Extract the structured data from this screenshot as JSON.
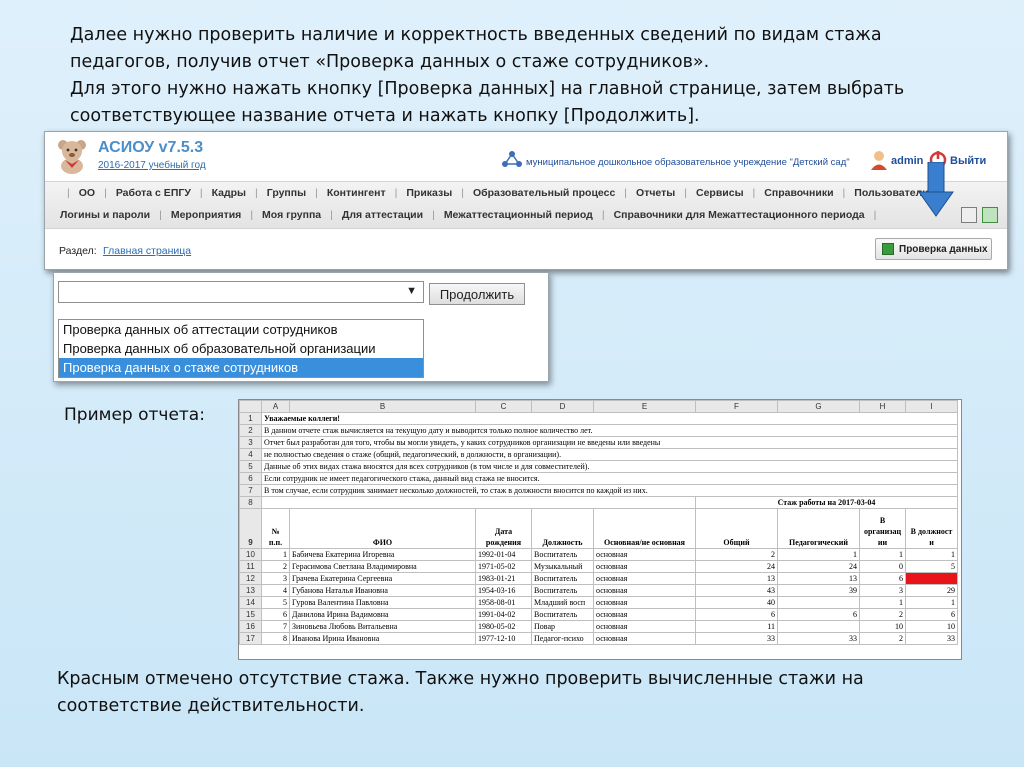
{
  "intro": {
    "line1": "Далее нужно проверить наличие и корректность введенных сведений по видам стажа",
    "line2": "педагогов, получив отчет «Проверка данных о стаже сотрудников».",
    "line3": "Для этого нужно нажать кнопку [Проверка данных] на главной странице, затем выбрать",
    "line4": "соответствующее название отчета и нажать кнопку [Продолжить]."
  },
  "app": {
    "title": "АСИОУ v7.5.3",
    "year": "2016-2017 учебный год",
    "org": "муниципальное дошкольное образовательное учреждение \"Детский сад\"",
    "user": "admin",
    "exit": "Выйти",
    "menu_row1": [
      "ОО",
      "Работа с ЕПГУ",
      "Кадры",
      "Группы",
      "Контингент",
      "Приказы",
      "Образовательный процесс",
      "Отчеты",
      "Сервисы",
      "Справочники",
      "Пользователи"
    ],
    "menu_row2": [
      "Логины и пароли",
      "Мероприятия",
      "Моя группа",
      "Для аттестации",
      "Межаттестационный период",
      "Справочники для Межаттестационного периода"
    ],
    "section_label": "Раздел:",
    "section_link": "Главная страница",
    "check_button": "Проверка данных",
    "colors": {
      "title": "#4a8fc9",
      "link": "#2a6db0",
      "highlight_arrow": "#3a7fcf"
    }
  },
  "dropdown": {
    "selected": "",
    "continue_button": "Продолжить",
    "options": [
      "Проверка данных об аттестации сотрудников",
      "Проверка данных об образовательной организации",
      "Проверка данных о стаже сотрудников"
    ],
    "highlighted_index": 2
  },
  "example_label": "Пример отчета:",
  "sheet": {
    "col_letters": [
      "A",
      "B",
      "C",
      "D",
      "E",
      "F",
      "G",
      "H",
      "I"
    ],
    "notes": [
      "Уважаемые коллеги!",
      "В данном отчете стаж вычисляется на текущую дату и выводится только полное количество лет.",
      "Отчет был разработан для того, чтобы вы могли увидеть, у каких сотрудников организации не введены или введены",
      "не полностью сведения о стаже (общий, педагогический, в должности, в организации).",
      "Данные об этих видах стажа вносятся для всех сотрудников (в том числе и для совместителей).",
      "Если сотрудник не имеет педагогического стажа, данный вид стажа не вносится.",
      "В том случае, если сотрудник занимает несколько должностей, то стаж в должности вносится по каждой из них."
    ],
    "group_header": "Стаж работы на 2017-03-04",
    "headers": [
      "№ п.п.",
      "ФИО",
      "Дата рождения",
      "Должность",
      "Основная/не основная",
      "Общий",
      "Педагогический",
      "В организац ии",
      "В должност и"
    ],
    "rows": [
      {
        "row": "10",
        "n": "1",
        "fio": "Бабичева Екатерина Игоревна",
        "dob": "1992-01-04",
        "pos": "Воспитатель",
        "type": "основная",
        "total": "2",
        "ped": "1",
        "org": "1",
        "dol": "1"
      },
      {
        "row": "11",
        "n": "2",
        "fio": "Герасимова Светлана Владимировна",
        "dob": "1971-05-02",
        "pos": "Музыкальный",
        "type": "основная",
        "total": "24",
        "ped": "24",
        "org": "0",
        "dol": "5"
      },
      {
        "row": "12",
        "n": "3",
        "fio": "Грачева Екатерина Сергеевна",
        "dob": "1983-01-21",
        "pos": "Воспитатель",
        "type": "основная",
        "total": "13",
        "ped": "13",
        "org": "6",
        "dol": ""
      },
      {
        "row": "13",
        "n": "4",
        "fio": "Губанова Наталья Ивановна",
        "dob": "1954-03-16",
        "pos": "Воспитатель",
        "type": "основная",
        "total": "43",
        "ped": "39",
        "org": "3",
        "dol": "29"
      },
      {
        "row": "14",
        "n": "5",
        "fio": "Гурова Валентина Павловна",
        "dob": "1958-08-01",
        "pos": "Младший восп",
        "type": "основная",
        "total": "40",
        "ped": "",
        "org": "1",
        "dol": "1"
      },
      {
        "row": "15",
        "n": "6",
        "fio": "Данилова Ирина Вадимовна",
        "dob": "1991-04-02",
        "pos": "Воспитатель",
        "type": "основная",
        "total": "6",
        "ped": "6",
        "org": "2",
        "dol": "6"
      },
      {
        "row": "16",
        "n": "7",
        "fio": "Зиновьева Любовь Витальевна",
        "dob": "1980-05-02",
        "pos": "Повар",
        "type": "основная",
        "total": "11",
        "ped": "",
        "org": "10",
        "dol": "10"
      },
      {
        "row": "17",
        "n": "8",
        "fio": "Иванова Ирина Ивановна",
        "dob": "1977-12-10",
        "pos": "Педагог-психо",
        "type": "основная",
        "total": "33",
        "ped": "33",
        "org": "2",
        "dol": "33"
      }
    ],
    "missing_color": "#e8141a"
  },
  "outro": {
    "line1": "Красным отмечено отсутствие стажа. Также нужно проверить вычисленные стажи на",
    "line2": "соответствие действительности."
  }
}
